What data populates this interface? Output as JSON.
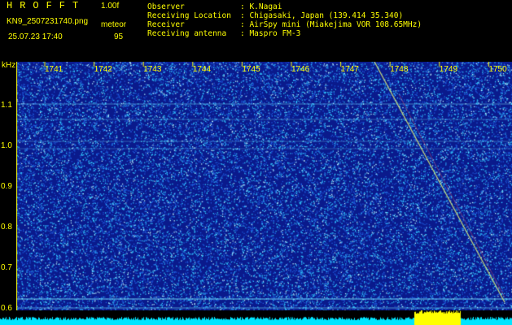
{
  "header": {
    "app_title": "HROFFT",
    "version": "1.00f",
    "file_name": "KN9_2507231740.png",
    "mode": "meteor",
    "datetime": "25.07.23 17:40",
    "count": "95"
  },
  "info": [
    {
      "key": "Observer",
      "value": ": K.Nagai"
    },
    {
      "key": "Receiving Location",
      "value": ": Chigasaki, Japan (139.414 35.340)"
    },
    {
      "key": "Receiver",
      "value": ": AirSpy mini (Miakejima VOR 108.65MHz)"
    },
    {
      "key": "Receiving antenna",
      "value": ": Maspro FM-3"
    }
  ],
  "spectrogram": {
    "y_unit": "kHz",
    "y_ticks": [
      "1.1",
      "1.0",
      "0.9",
      "0.8",
      "0.7",
      "0.6"
    ],
    "x_ticks": [
      "1741",
      "1742",
      "1743",
      "1744",
      "1745",
      "1746",
      "1747",
      "1748",
      "1749",
      "1750"
    ],
    "colors": {
      "background": "#0a1a8c",
      "noise": "#32c8ff",
      "accent": "#ffff00",
      "bar": "#00e5ff"
    }
  }
}
